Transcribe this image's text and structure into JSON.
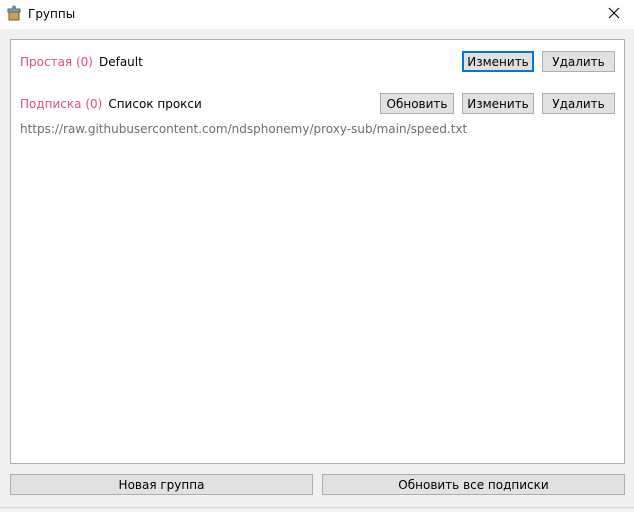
{
  "window": {
    "title": "Группы",
    "close_symbol": "✕"
  },
  "groups": [
    {
      "type": "Простая (0)",
      "name": "Default",
      "edit_label": "Изменить",
      "delete_label": "Удалить"
    },
    {
      "type": "Подписка (0)",
      "name": "Список прокси",
      "update_label": "Обновить",
      "edit_label": "Изменить",
      "delete_label": "Удалить",
      "url": "https://raw.githubusercontent.com/ndsphonemy/proxy-sub/main/speed.txt"
    }
  ],
  "footer": {
    "new_group_label": "Новая группа",
    "update_all_label": "Обновить все подписки"
  },
  "colors": {
    "type_label": "#e0507a",
    "url": "#6d6d6d",
    "default_button_border": "#0078d7"
  }
}
